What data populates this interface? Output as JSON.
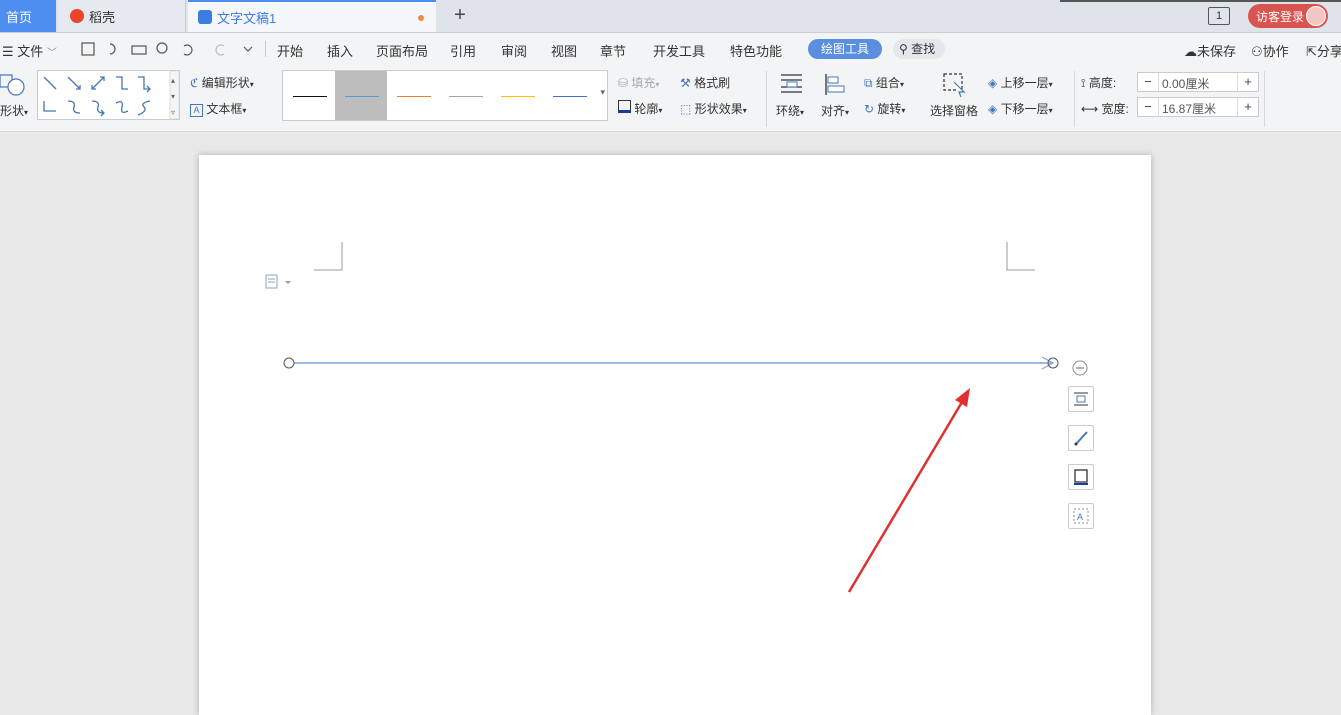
{
  "tabs": {
    "home": "首页",
    "daoke": "稻壳",
    "doc": "文字文稿1"
  },
  "window_count": "1",
  "login": "访客登录",
  "menu": {
    "file": "文件",
    "items": [
      "开始",
      "插入",
      "页面布局",
      "引用",
      "审阅",
      "视图",
      "章节",
      "开发工具",
      "特色功能"
    ],
    "active": "绘图工具",
    "search": "查找",
    "unsaved": "未保存",
    "collab": "协作",
    "share": "分享"
  },
  "ribbon": {
    "shape": "形状",
    "edit_shape": "编辑形状",
    "textbox": "文本框",
    "fill": "填充",
    "format_painter": "格式刷",
    "outline": "轮廓",
    "shape_effect": "形状效果",
    "wrap": "环绕",
    "align": "对齐",
    "group": "组合",
    "rotate": "旋转",
    "select_pane": "选择窗格",
    "bring_forward": "上移一层",
    "send_backward": "下移一层",
    "height_label": "高度:",
    "height_value": "0.00厘米",
    "width_label": "宽度:",
    "width_value": "16.87厘米",
    "minus": "−",
    "plus": "+"
  },
  "line_styles": [
    "#111111",
    "#5b9bd5",
    "#ed7d31",
    "#a5a5a5",
    "#ffc000",
    "#4472c4"
  ],
  "colors": {
    "accent": "#4d8ef0",
    "annotation": "#e03131",
    "selected_line": "#7fa6d8"
  }
}
